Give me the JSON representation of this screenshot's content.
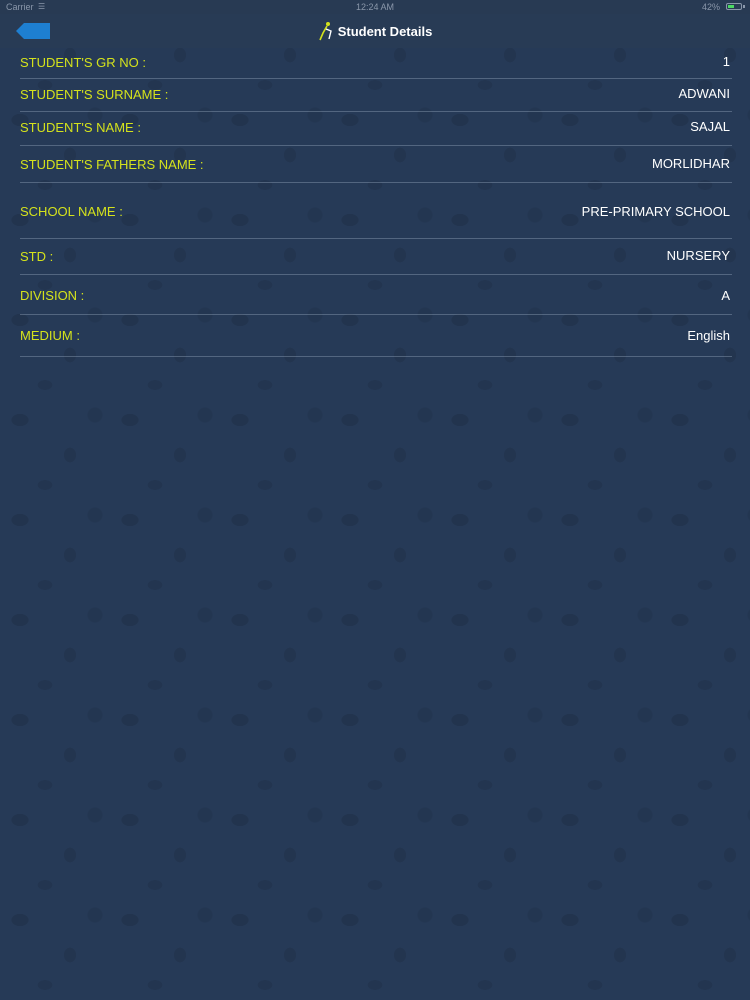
{
  "status_bar": {
    "carrier": "Carrier",
    "time": "12:24 AM",
    "battery_percent": "42%",
    "battery_level": 0.42,
    "battery_color": "#4cd964"
  },
  "nav": {
    "back_icon": "back-arrow-icon",
    "back_color": "#1e7fd1",
    "logo_icon": "school-logo-icon",
    "title": "Student Details"
  },
  "colors": {
    "label": "#d4e21c",
    "value": "#ffffff",
    "background": "#263a57"
  },
  "details": [
    {
      "label": "STUDENT'S GR NO :",
      "value": "1"
    },
    {
      "label": "STUDENT'S SURNAME :",
      "value": "ADWANI"
    },
    {
      "label": "STUDENT'S NAME :",
      "value": "SAJAL"
    },
    {
      "label": "STUDENT'S FATHERS NAME :",
      "value": "MORLIDHAR"
    },
    {
      "label": "SCHOOL NAME :",
      "value": "PRE-PRIMARY SCHOOL"
    },
    {
      "label": "STD :",
      "value": "NURSERY"
    },
    {
      "label": "DIVISION :",
      "value": "A"
    },
    {
      "label": "MEDIUM :",
      "value": "English"
    }
  ]
}
